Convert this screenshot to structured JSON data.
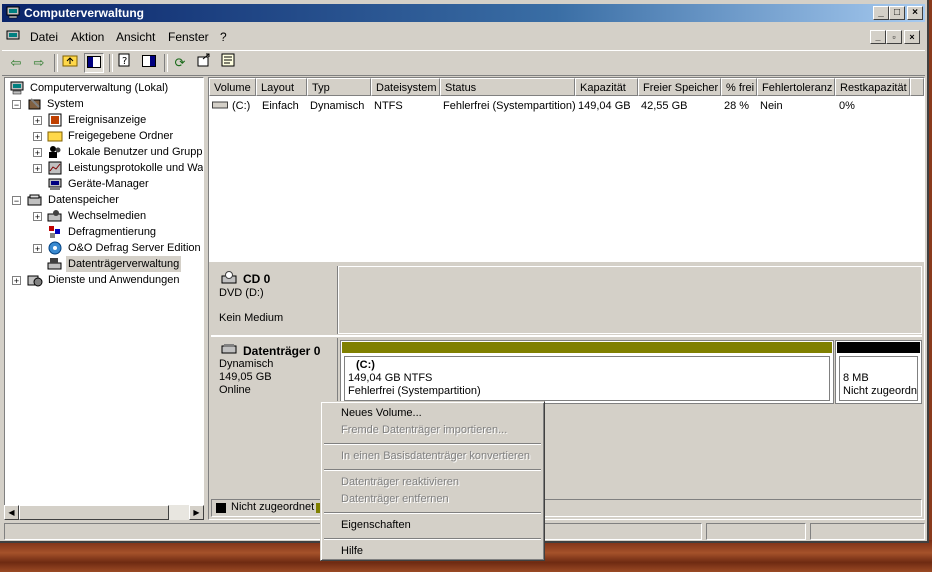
{
  "window": {
    "title": "Computerverwaltung",
    "title_buttons": [
      "_",
      "□",
      "×"
    ]
  },
  "menu": {
    "items": [
      "Datei",
      "Aktion",
      "Ansicht",
      "Fenster",
      "?"
    ]
  },
  "mdi_buttons": [
    "_",
    "▫",
    "×"
  ],
  "toolbar": {
    "icons": [
      "back-icon",
      "forward-icon",
      "up-folder-icon",
      "show-hide-tree-icon",
      "properties-icon",
      "show-hide-actionpane-icon",
      "refresh-icon",
      "export-icon",
      "help-icon"
    ]
  },
  "tree": {
    "root": "Computerverwaltung (Lokal)",
    "items": [
      {
        "label": "System",
        "expander": "−"
      },
      {
        "label": "Ereignisanzeige",
        "expander": "+"
      },
      {
        "label": "Freigegebene Ordner",
        "expander": "+"
      },
      {
        "label": "Lokale Benutzer und Gruppen",
        "expander": "+"
      },
      {
        "label": "Leistungsprotokolle und Warnungen",
        "expander": "+"
      },
      {
        "label": "Geräte-Manager",
        "expander": ""
      },
      {
        "label": "Datenspeicher",
        "expander": "−"
      },
      {
        "label": "Wechselmedien",
        "expander": "+"
      },
      {
        "label": "Defragmentierung",
        "expander": ""
      },
      {
        "label": "O&O Defrag Server Edition",
        "expander": "+"
      },
      {
        "label": "Datenträgerverwaltung",
        "expander": ""
      },
      {
        "label": "Dienste und Anwendungen",
        "expander": "+"
      }
    ]
  },
  "list": {
    "columns": [
      "Volume",
      "Layout",
      "Typ",
      "Dateisystem",
      "Status",
      "Kapazität",
      "Freier Speicher",
      "% frei",
      "Fehlertoleranz",
      "Restkapazität"
    ],
    "rows": [
      [
        "(C:)",
        "Einfach",
        "Dynamisch",
        "NTFS",
        "Fehlerfrei (Systempartition)",
        "149,04 GB",
        "42,55 GB",
        "28 %",
        "Nein",
        "0%"
      ]
    ]
  },
  "disks": [
    {
      "name": "CD 0",
      "type": "DVD (D:)",
      "status": "Kein Medium"
    },
    {
      "name": "Datenträger 0",
      "type": "Dynamisch",
      "size": "149,05 GB",
      "status": "Online",
      "volumes": [
        {
          "label": "(C:)",
          "size": "149,04 GB NTFS",
          "status": "Fehlerfrei (Systempartition)",
          "bar_color": "#808000"
        },
        {
          "label": "",
          "size": "8 MB",
          "status": "Nicht zugeordnet",
          "bar_color": "#000000"
        }
      ]
    }
  ],
  "legend": {
    "items": [
      {
        "label": "Nicht zugeordnet",
        "color": "#000000"
      }
    ]
  },
  "context_menu": {
    "items": [
      {
        "label": "Neues Volume...",
        "enabled": true
      },
      {
        "label": "Fremde Datenträger importieren...",
        "enabled": false
      },
      {
        "label": "In einen Basisdatenträger konvertieren",
        "enabled": false
      },
      {
        "label": "Datenträger reaktivieren",
        "enabled": false
      },
      {
        "label": "Datenträger entfernen",
        "enabled": false
      },
      {
        "label": "Eigenschaften",
        "enabled": true
      },
      {
        "label": "Hilfe",
        "enabled": true
      }
    ]
  }
}
